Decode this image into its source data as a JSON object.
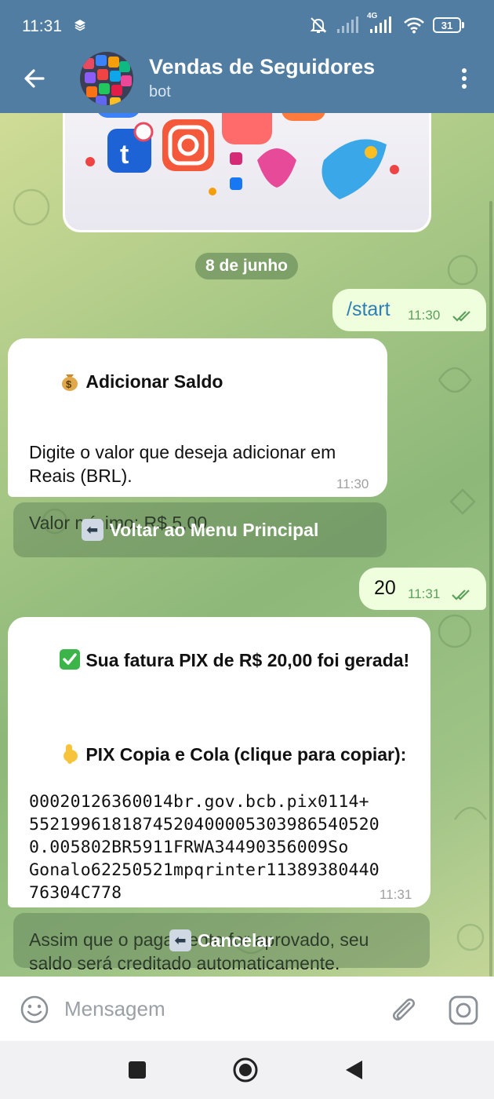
{
  "status_bar": {
    "time": "11:31",
    "network": "4G",
    "battery": "31"
  },
  "header": {
    "title": "Vendas de Seguidores",
    "subtitle": "bot"
  },
  "chat": {
    "date_label": "8 de junho",
    "messages": [
      {
        "direction": "out",
        "text": "/start",
        "time": "11:30",
        "status": "read"
      },
      {
        "direction": "in",
        "heading_emoji": "money-bag",
        "heading": "Adicionar Saldo",
        "body_line1": "Digite o valor que deseja adicionar em",
        "body_line2": "Reais (BRL).",
        "body_line3": "Valor mínimo: R$ 5,00",
        "time": "11:30",
        "button": {
          "emoji": "back-arrow",
          "label": "Voltar ao Menu Principal"
        }
      },
      {
        "direction": "out",
        "text": "20",
        "time": "11:31",
        "status": "read"
      },
      {
        "direction": "in",
        "heading_emoji": "check-mark",
        "heading": "Sua fatura PIX de R$ 20,00 foi gerada!",
        "sub_emoji": "pointing-down",
        "sub_heading": "PIX Copia e Cola (clique para copiar):",
        "code_lines": [
          "00020126360014br.gov.bcb.pix0114+",
          "5521996181874520400005303986540520",
          "0.005802BR5911FRWA34490356009So",
          "Gonalo62250521mpqrinter11389380440",
          "76304C778"
        ],
        "footer_line1": "Assim que o pagamento for aprovado, seu",
        "footer_line2": "saldo será creditado automaticamente.",
        "time": "11:31",
        "button": {
          "emoji": "back-arrow",
          "label": "Cancelar"
        }
      }
    ]
  },
  "input": {
    "placeholder": "Mensagem"
  },
  "colors": {
    "header": "#517da2",
    "outgoing_bubble": "#effedd",
    "incoming_bubble": "#ffffff",
    "read_ticks": "#5ca05c",
    "link_text": "#2d7fb4"
  }
}
